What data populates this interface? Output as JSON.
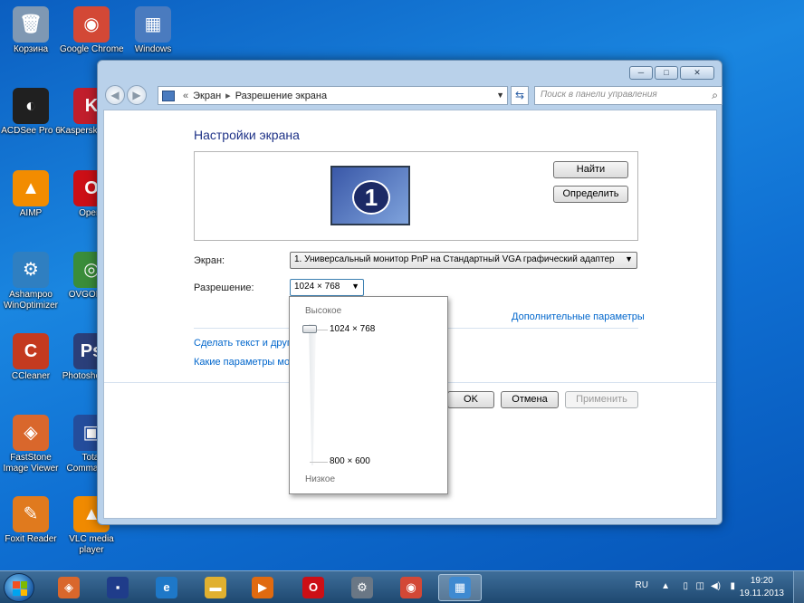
{
  "desktop": {
    "icons": [
      {
        "label": "Корзина",
        "color": "#7f98b3",
        "glyph": "🗑"
      },
      {
        "label": "Google Chrome",
        "color": "#d34836",
        "glyph": "◉"
      },
      {
        "label": "Windows",
        "color": "#4a7bbf",
        "glyph": "▦"
      },
      {
        "label": "ACDSee Pro 6",
        "color": "#202020",
        "glyph": "◐"
      },
      {
        "label": "Kaspersky Internet",
        "color": "#c11e2c",
        "glyph": "K"
      },
      {
        "label": "AIMP",
        "color": "#f28c00",
        "glyph": "▲"
      },
      {
        "label": "Opera",
        "color": "#cc0f16",
        "glyph": "O"
      },
      {
        "label": "Ashampoo WinOptimizer",
        "color": "#2f7fc1",
        "glyph": "⚙"
      },
      {
        "label": "OVGORSK",
        "color": "#3a8d3a",
        "glyph": "◎"
      },
      {
        "label": "CCleaner",
        "color": "#c43a1f",
        "glyph": "C"
      },
      {
        "label": "Photoshop CS",
        "color": "#2b3f7a",
        "glyph": "Ps"
      },
      {
        "label": "FastStone Image Viewer",
        "color": "#d9672c",
        "glyph": "◈"
      },
      {
        "label": "Total Commander",
        "color": "#244d9c",
        "glyph": "▣"
      },
      {
        "label": "Foxit Reader",
        "color": "#e07a1e",
        "glyph": "✎"
      },
      {
        "label": "VLC media player",
        "color": "#f08a00",
        "glyph": "▲"
      }
    ]
  },
  "window": {
    "controls": {
      "minimize": "─",
      "maximize": "□",
      "close": "✕"
    },
    "breadcrumb_root": "Экран",
    "breadcrumb_current": "Разрешение экрана",
    "search_placeholder": "Поиск в панели управления",
    "title": "Настройки экрана",
    "buttons": {
      "find": "Найти",
      "identify": "Определить",
      "ok": "OK",
      "cancel": "Отмена",
      "apply": "Применить"
    },
    "monitor_number": "1",
    "display_label": "Экран:",
    "display_value": "1. Универсальный монитор PnP на Стандартный VGA графический адаптер",
    "resolution_label": "Разрешение:",
    "resolution_value": "1024 × 768",
    "advanced_link": "Дополнительные параметры",
    "link_text_size": "Сделать текст и другие",
    "link_which_params": "Какие параметры мон"
  },
  "resolution_popup": {
    "high_label": "Высокое",
    "low_label": "Низкое",
    "top_value": "1024 × 768",
    "bottom_value": "800 × 600",
    "slider_level": 1.0
  },
  "taskbar": {
    "items": [
      {
        "name": "faststone",
        "color": "#d9672c",
        "glyph": "◈"
      },
      {
        "name": "save",
        "color": "#1f3c8a",
        "glyph": "▪"
      },
      {
        "name": "internet-explorer",
        "color": "#1e78c8",
        "glyph": "e"
      },
      {
        "name": "explorer",
        "color": "#e0b030",
        "glyph": "▬"
      },
      {
        "name": "media-player",
        "color": "#e06a10",
        "glyph": "▶"
      },
      {
        "name": "opera",
        "color": "#cc0f16",
        "glyph": "O"
      },
      {
        "name": "settings",
        "color": "#6a7785",
        "glyph": "⚙"
      },
      {
        "name": "chrome",
        "color": "#d34836",
        "glyph": "◉"
      },
      {
        "name": "control-panel",
        "color": "#3f8ad1",
        "glyph": "▦"
      }
    ],
    "language": "RU",
    "time": "19:20",
    "date": "19.11.2013"
  }
}
